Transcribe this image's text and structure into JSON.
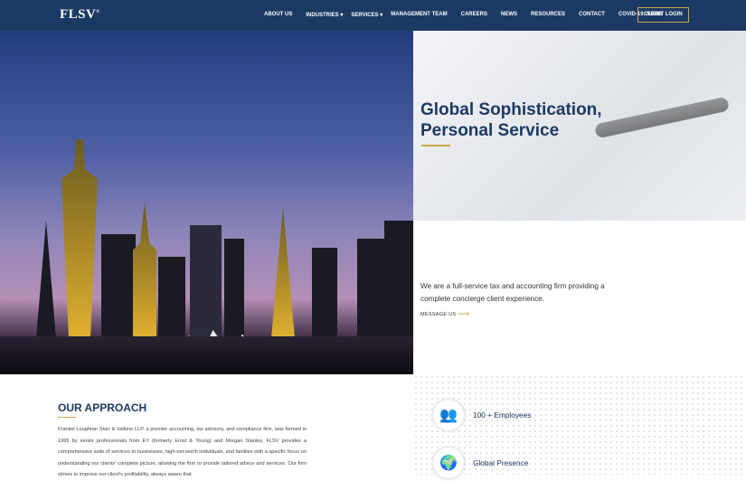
{
  "nav": {
    "logo": "FLSV",
    "items": [
      "ABOUT US",
      "INDUSTRIES",
      "SERVICES",
      "MANAGEMENT TEAM",
      "CAREERS",
      "NEWS",
      "RESOURCES",
      "CONTACT",
      "COVID-19: NEWS"
    ],
    "login": "CLIENT LOGIN"
  },
  "hero": {
    "title_line1": "Global Sophistication,",
    "title_line2": "Personal Service",
    "lead": "We are a full-service tax and accounting firm providing a complete concierge client experience.",
    "cta": "MESSAGE US"
  },
  "approach": {
    "title": "OUR APPROACH",
    "body": "Frankel Loughran Starr & Vallone LLP, a premier accounting, tax advisory, and compliance firm, was formed in 1995 by senior professionals from EY (formerly Ernst & Young) and Morgan Stanley. FLSV provides a comprehensive suite of services to businesses, high-net-worth individuals, and families with a specific focus on understanding our clients' complete picture, allowing the firm to provide tailored advice and services. Our firm strives to improve our client's profitability, always aware that"
  },
  "stats": [
    {
      "label": "100 + Employees",
      "icon": "people-icon"
    },
    {
      "label": "Global Presence",
      "icon": "globe-icon"
    }
  ],
  "colors": {
    "navy": "#1b3a63",
    "gold": "#c9a84a"
  }
}
